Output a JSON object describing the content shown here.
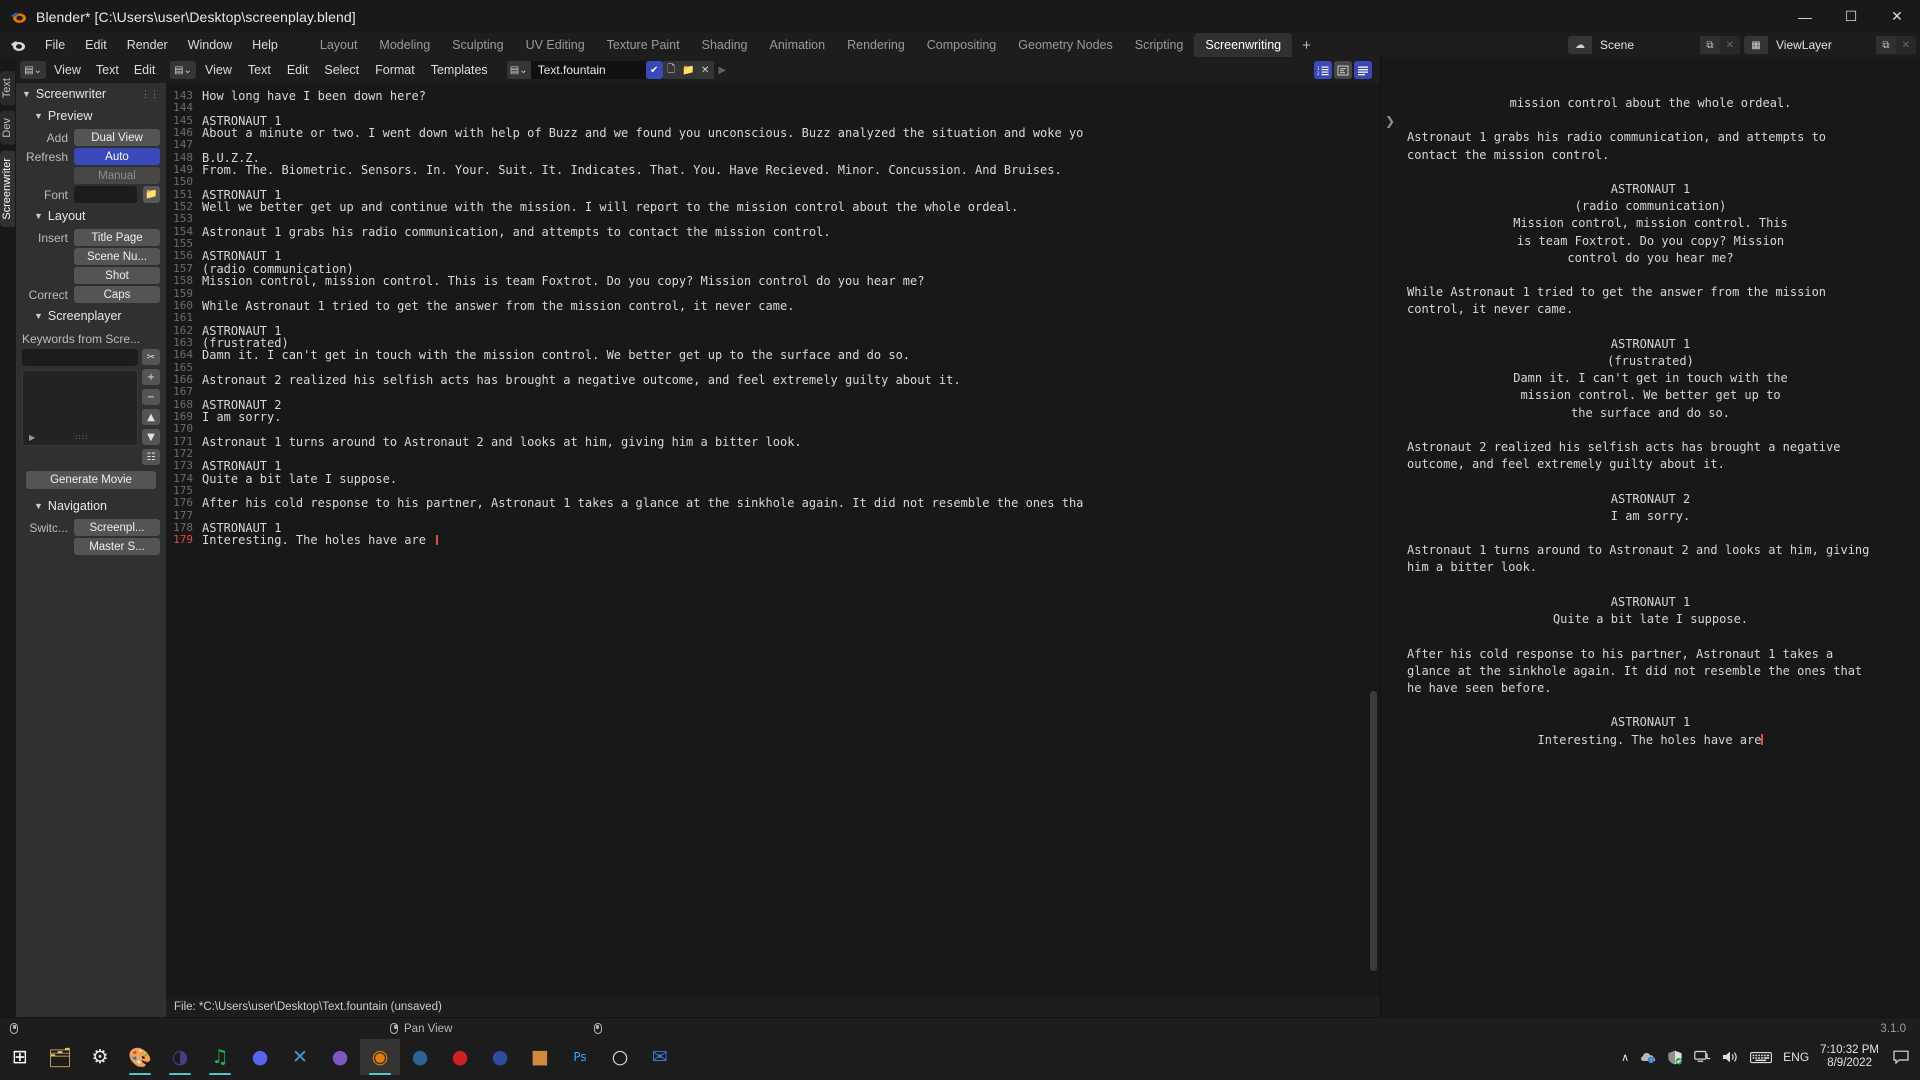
{
  "window": {
    "title": "Blender* [C:\\Users\\user\\Desktop\\screenplay.blend]",
    "minimize": "—",
    "maximize": "☐",
    "close": "✕"
  },
  "topbar": {
    "menus": [
      "File",
      "Edit",
      "Render",
      "Window",
      "Help"
    ],
    "workspaces": [
      {
        "label": "Layout",
        "active": false
      },
      {
        "label": "Modeling",
        "active": false
      },
      {
        "label": "Sculpting",
        "active": false
      },
      {
        "label": "UV Editing",
        "active": false
      },
      {
        "label": "Texture Paint",
        "active": false
      },
      {
        "label": "Shading",
        "active": false
      },
      {
        "label": "Animation",
        "active": false
      },
      {
        "label": "Rendering",
        "active": false
      },
      {
        "label": "Compositing",
        "active": false
      },
      {
        "label": "Geometry Nodes",
        "active": false
      },
      {
        "label": "Scripting",
        "active": false
      },
      {
        "label": "Screenwriting",
        "active": true
      }
    ],
    "add_workspace": "+",
    "scene": {
      "name": "Scene",
      "new_icon": "⧉",
      "unlink_icon": "✕"
    },
    "viewlayer": {
      "name": "ViewLayer",
      "new_icon": "⧉",
      "unlink_icon": "✕"
    }
  },
  "vertical_tabs": [
    {
      "label": "Text",
      "active": false
    },
    {
      "label": "Dev",
      "active": false
    },
    {
      "label": "Screenwriter",
      "active": true
    }
  ],
  "sidebar": {
    "header_menus": [
      "View",
      "Text",
      "Edit"
    ],
    "panels": {
      "screenwriter": "Screenwriter",
      "preview": "Preview",
      "layout": "Layout",
      "screenplayer": "Screenplayer",
      "navigation": "Navigation"
    },
    "preview": {
      "add_label": "Add",
      "add_value": "Dual View",
      "refresh_label": "Refresh",
      "refresh_auto": "Auto",
      "refresh_manual": "Manual",
      "font_label": "Font",
      "font_value": "",
      "font_browse_icon": "folder-icon"
    },
    "layout": {
      "insert_label": "Insert",
      "insert_title_page": "Title Page",
      "insert_scene_number": "Scene Nu...",
      "insert_shot": "Shot",
      "correct_label": "Correct",
      "correct_caps": "Caps"
    },
    "screenplayer": {
      "keywords_label": "Keywords from Scre...",
      "search_value": "",
      "list_items": [],
      "buttons": [
        "eyedropper-icon",
        "plus-icon",
        "minus-icon",
        "up-arrow-icon",
        "down-arrow-icon",
        "duplicate-icon"
      ]
    },
    "generate_movie": "Generate Movie",
    "navigation": {
      "switch_label": "Switc...",
      "screenplay_btn": "Screenpl...",
      "master_btn": "Master S..."
    }
  },
  "editor": {
    "header_menus": [
      "View",
      "Text",
      "Edit",
      "Select",
      "Format",
      "Templates"
    ],
    "datablock_name": "Text.fountain",
    "icons": {
      "editor_type": "text-editor-icon",
      "browse": "browse-icon",
      "live_edit": "shield-icon",
      "new_text": "new-document-icon",
      "open_text": "open-folder-icon",
      "unlink": "x-icon",
      "run_script": "play-icon",
      "line_numbers": "line-numbers-icon",
      "word_wrap": "word-wrap-icon",
      "syntax_highlight": "syntax-icon"
    },
    "first_line_number": 143,
    "lines": [
      "How long have I been down here?",
      "",
      "ASTRONAUT 1",
      "About a minute or two. I went down with help of Buzz and we found you unconscious. Buzz analyzed the situation and woke yo",
      "",
      "B.U.Z.Z.",
      "From. The. Biometric. Sensors. In. Your. Suit. It. Indicates. That. You. Have Recieved. Minor. Concussion. And Bruises.",
      "",
      "ASTRONAUT 1",
      "Well we better get up and continue with the mission. I will report to the mission control about the whole ordeal.",
      "",
      "Astronaut 1 grabs his radio communication, and attempts to contact the mission control.",
      "",
      "ASTRONAUT 1",
      "(radio communication)",
      "Mission control, mission control. This is team Foxtrot. Do you copy? Mission control do you hear me?",
      "",
      "While Astronaut 1 tried to get the answer from the mission control, it never came.",
      "",
      "ASTRONAUT 1",
      "(frustrated)",
      "Damn it. I can't get in touch with the mission control. We better get up to the surface and do so.",
      "",
      "Astronaut 2 realized his selfish acts has brought a negative outcome, and feel extremely guilty about it.",
      "",
      "ASTRONAUT 2",
      "I am sorry.",
      "",
      "Astronaut 1 turns around to Astronaut 2 and looks at him, giving him a bitter look.",
      "",
      "ASTRONAUT 1",
      "Quite a bit late I suppose.",
      "",
      "After his cold response to his partner, Astronaut 1 takes a glance at the sinkhole again. It did not resemble the ones tha",
      "",
      "ASTRONAUT 1",
      "Interesting. The holes have are "
    ],
    "cursor_line": 179,
    "file_status": "File: *C:\\Users\\user\\Desktop\\Text.fountain (unsaved)"
  },
  "preview_panel": {
    "blocks": [
      {
        "align": "center",
        "text": "mission control about the whole ordeal."
      },
      {
        "align": "left",
        "text": ""
      },
      {
        "align": "left",
        "text": "Astronaut 1 grabs his radio communication, and attempts to"
      },
      {
        "align": "left",
        "text": "contact the mission control."
      },
      {
        "align": "left",
        "text": ""
      },
      {
        "align": "center",
        "text": "ASTRONAUT 1"
      },
      {
        "align": "center",
        "text": "(radio communication)"
      },
      {
        "align": "center",
        "text": "Mission control, mission control. This"
      },
      {
        "align": "center",
        "text": "is team Foxtrot. Do you copy? Mission"
      },
      {
        "align": "center",
        "text": "control do you hear me?"
      },
      {
        "align": "left",
        "text": ""
      },
      {
        "align": "left",
        "text": "While Astronaut 1 tried to get the answer from the mission"
      },
      {
        "align": "left",
        "text": "control, it never came."
      },
      {
        "align": "left",
        "text": ""
      },
      {
        "align": "center",
        "text": "ASTRONAUT 1"
      },
      {
        "align": "center",
        "text": "(frustrated)"
      },
      {
        "align": "center",
        "text": "Damn it. I can't get in touch with the"
      },
      {
        "align": "center",
        "text": "mission control. We better get up to"
      },
      {
        "align": "center",
        "text": "the surface and do so."
      },
      {
        "align": "left",
        "text": ""
      },
      {
        "align": "left",
        "text": "Astronaut 2 realized his selfish acts has brought a negative"
      },
      {
        "align": "left",
        "text": "outcome, and feel extremely guilty about it."
      },
      {
        "align": "left",
        "text": ""
      },
      {
        "align": "center",
        "text": "ASTRONAUT 2"
      },
      {
        "align": "center",
        "text": "I am sorry."
      },
      {
        "align": "left",
        "text": ""
      },
      {
        "align": "left",
        "text": "Astronaut 1 turns around to Astronaut 2 and looks at him, giving"
      },
      {
        "align": "left",
        "text": "him a bitter look."
      },
      {
        "align": "left",
        "text": ""
      },
      {
        "align": "center",
        "text": "ASTRONAUT 1"
      },
      {
        "align": "center",
        "text": "Quite a bit late I suppose."
      },
      {
        "align": "left",
        "text": ""
      },
      {
        "align": "left",
        "text": "After his cold response to his partner, Astronaut 1 takes a"
      },
      {
        "align": "left",
        "text": "glance at the sinkhole again. It did not resemble the ones that"
      },
      {
        "align": "left",
        "text": "he have seen before."
      },
      {
        "align": "left",
        "text": ""
      },
      {
        "align": "center",
        "text": "ASTRONAUT 1"
      },
      {
        "align": "center-cursor",
        "text": "Interesting. The holes have are"
      }
    ]
  },
  "status_bar": {
    "pan_view": "Pan View",
    "version": "3.1.0"
  },
  "taskbar": {
    "items": [
      {
        "name": "start-button",
        "glyph": "⊞",
        "color": "#ffffff",
        "active": false,
        "running": false
      },
      {
        "name": "file-explorer",
        "glyph": "🗂",
        "color": "#f0c060",
        "active": false,
        "running": false
      },
      {
        "name": "settings",
        "glyph": "⚙",
        "color": "#e8e8e8",
        "active": false,
        "running": false
      },
      {
        "name": "paint-app",
        "glyph": "🎨",
        "color": "#d8734a",
        "active": false,
        "running": true
      },
      {
        "name": "browser-app",
        "glyph": "◑",
        "color": "#4a3a8a",
        "active": false,
        "running": true
      },
      {
        "name": "spotify",
        "glyph": "♫",
        "color": "#1db954",
        "active": false,
        "running": true
      },
      {
        "name": "discord",
        "glyph": "●",
        "color": "#5865f2",
        "active": false,
        "running": false
      },
      {
        "name": "vscode",
        "glyph": "✕",
        "color": "#3b9ade",
        "active": false,
        "running": false
      },
      {
        "name": "github-desktop",
        "glyph": "●",
        "color": "#7e57c2",
        "active": false,
        "running": false
      },
      {
        "name": "blender",
        "glyph": "◉",
        "color": "#e87d0d",
        "active": true,
        "running": true
      },
      {
        "name": "steam",
        "glyph": "●",
        "color": "#2a6496",
        "active": false,
        "running": false
      },
      {
        "name": "krita",
        "glyph": "●",
        "color": "#d02020",
        "active": false,
        "running": false
      },
      {
        "name": "audio-app",
        "glyph": "●",
        "color": "#2b4ea0",
        "active": false,
        "running": false
      },
      {
        "name": "media-app",
        "glyph": "■",
        "color": "#d08a3a",
        "active": false,
        "running": false
      },
      {
        "name": "photoshop",
        "glyph": "Ps",
        "color": "#31a8ff",
        "active": false,
        "running": false
      },
      {
        "name": "ring-app",
        "glyph": "○",
        "color": "#dedede",
        "active": false,
        "running": false
      },
      {
        "name": "mail-app",
        "glyph": "✉",
        "color": "#3b7dd8",
        "active": false,
        "running": false
      }
    ],
    "tray": {
      "chevron": "∧",
      "onedrive": "onedrive-icon",
      "defender": "shield-icon",
      "network": "network-icon",
      "volume": "volume-icon",
      "keyboard": "keyboard-icon",
      "language": "ENG",
      "time": "7:10:32 PM",
      "date": "8/9/2022",
      "notifications": "notification-icon"
    }
  }
}
